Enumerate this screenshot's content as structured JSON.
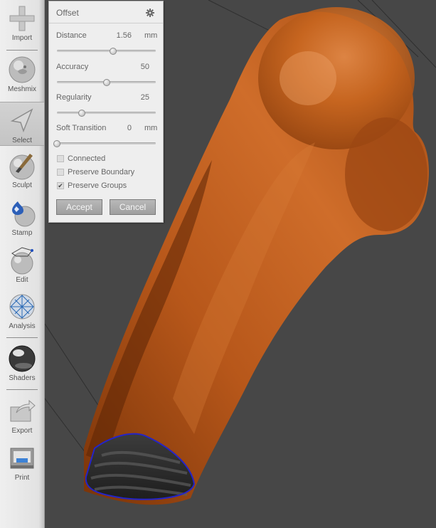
{
  "toolbar": {
    "items": [
      {
        "label": "Import",
        "icon": "plus-icon"
      },
      {
        "label": "Meshmix",
        "icon": "bunny-sphere-icon"
      },
      {
        "label": "Select",
        "icon": "arrow-cursor-icon",
        "active": true
      },
      {
        "label": "Sculpt",
        "icon": "brush-sphere-icon"
      },
      {
        "label": "Stamp",
        "icon": "stamp-sphere-icon"
      },
      {
        "label": "Edit",
        "icon": "edit-mesh-icon"
      },
      {
        "label": "Analysis",
        "icon": "analysis-mesh-icon"
      },
      {
        "label": "Shaders",
        "icon": "chrome-sphere-icon"
      },
      {
        "label": "Export",
        "icon": "export-arrow-icon"
      },
      {
        "label": "Print",
        "icon": "printer-icon"
      }
    ]
  },
  "panel": {
    "title": "Offset",
    "settings_icon": "gear-icon",
    "params": [
      {
        "label": "Distance",
        "value": "1.56",
        "unit": "mm",
        "fraction": 0.57
      },
      {
        "label": "Accuracy",
        "value": "50",
        "unit": "",
        "fraction": 0.5
      },
      {
        "label": "Regularity",
        "value": "25",
        "unit": "",
        "fraction": 0.25
      },
      {
        "label": "Soft Transition",
        "value": "0",
        "unit": "mm",
        "fraction": 0.0
      }
    ],
    "checks": [
      {
        "label": "Connected",
        "checked": false
      },
      {
        "label": "Preserve Boundary",
        "checked": false
      },
      {
        "label": "Preserve Groups",
        "checked": true
      }
    ],
    "accept_label": "Accept",
    "cancel_label": "Cancel"
  },
  "viewport": {
    "background": "#474747",
    "mesh_color": "#c0601c",
    "boundary_color": "#2424c8"
  }
}
